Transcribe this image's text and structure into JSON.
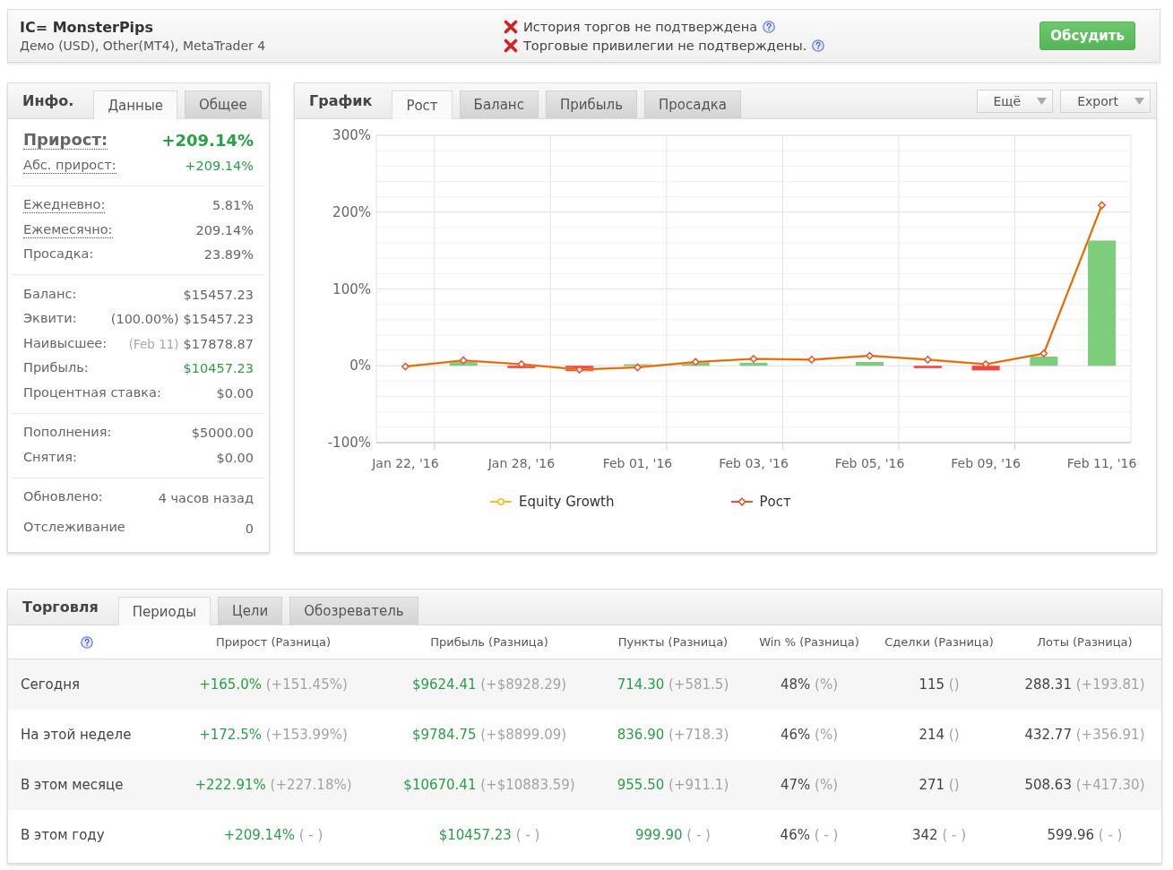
{
  "header": {
    "title": "IC= MonsterPips",
    "subtitle": "Демо (USD), Other(MT4), MetaTrader 4",
    "warnings": [
      {
        "text": "История торгов не подтверждена",
        "verified": false
      },
      {
        "text": "Торговые привилегии не подтверждены.",
        "verified": false
      }
    ],
    "button": "Обсудить"
  },
  "info_panel": {
    "title": "Инфо.",
    "tabs": [
      {
        "label": "Данные",
        "selected": true
      },
      {
        "label": "Общее",
        "selected": false
      }
    ],
    "sections": [
      {
        "rows": [
          {
            "kind": "headline",
            "label": "Прирост:",
            "value": "+209.14%",
            "dotted": true,
            "positive": true
          },
          {
            "kind": "row",
            "label": "Абс. прирост:",
            "value": "+209.14%",
            "dotted": true,
            "positive": true
          }
        ]
      },
      {
        "rows": [
          {
            "kind": "row",
            "label": "Ежедневно:",
            "value": "5.81%",
            "dotted": true,
            "positive": false
          },
          {
            "kind": "row",
            "label": "Ежемесячно:",
            "value": "209.14%",
            "dotted": true,
            "positive": false
          },
          {
            "kind": "row",
            "label": "Просадка:",
            "value": "23.89%",
            "dotted": false,
            "positive": false
          }
        ]
      },
      {
        "rows": [
          {
            "kind": "row",
            "label": "Баланс:",
            "value": "$15457.23",
            "dotted": false,
            "positive": false
          },
          {
            "kind": "row",
            "label": "Эквити:",
            "note": {
              "text": "(100.00%)",
              "muted": false
            },
            "value": "$15457.23",
            "dotted": false,
            "positive": false
          },
          {
            "kind": "row",
            "label": "Наивысшее:",
            "note": {
              "text": "(Feb 11)",
              "muted": true
            },
            "value": "$17878.87",
            "dotted": false,
            "positive": false
          },
          {
            "kind": "row",
            "label": "Прибыль:",
            "value": "$10457.23",
            "dotted": false,
            "positive": true
          },
          {
            "kind": "row",
            "label": "Процентная ставка:",
            "value": "$0.00",
            "dotted": false,
            "positive": false
          }
        ]
      },
      {
        "rows": [
          {
            "kind": "row",
            "label": "Пополнения:",
            "value": "$5000.00",
            "dotted": false,
            "positive": false
          },
          {
            "kind": "row",
            "label": "Снятия:",
            "value": "$0.00",
            "dotted": false,
            "positive": false
          }
        ]
      },
      {
        "rows": [
          {
            "kind": "row",
            "label": "Обновлено:",
            "value": "4 часов назад",
            "dotted": false,
            "positive": false
          },
          {
            "kind": "row",
            "label": "Отслеживание",
            "value": "0",
            "dotted": false,
            "positive": false
          }
        ]
      }
    ]
  },
  "chart_panel": {
    "title": "График",
    "tabs": [
      {
        "label": "Рост",
        "selected": true
      },
      {
        "label": "Баланс",
        "selected": false
      },
      {
        "label": "Прибыль",
        "selected": false
      },
      {
        "label": "Просадка",
        "selected": false
      }
    ],
    "menus": [
      "Ещё",
      "Export"
    ],
    "chart_data": {
      "type": "line",
      "categories": [
        "Jan 22, '16",
        null,
        "Jan 28, '16",
        null,
        "Feb 01, '16",
        null,
        "Feb 03, '16",
        null,
        "Feb 05, '16",
        null,
        "Feb 09, '16",
        null,
        "Feb 11, '16"
      ],
      "ylim": [
        -100,
        300
      ],
      "yticks": [
        {
          "value": 300,
          "label": "300%"
        },
        {
          "value": 200,
          "label": "200%"
        },
        {
          "value": 100,
          "label": "100%"
        },
        {
          "value": 0,
          "label": "0%"
        },
        {
          "value": -100,
          "label": "-100%"
        }
      ],
      "grid": true,
      "legend": "bottom",
      "series": [
        {
          "name": "Equity Growth",
          "color": "#f2c01e",
          "values": [
            -1,
            7,
            2,
            -5,
            -2,
            5,
            9,
            8,
            13,
            8,
            2,
            16,
            209
          ]
        },
        {
          "name": "Рост",
          "color": "#e8532b",
          "marker": "diamond",
          "values": [
            -1,
            7,
            2,
            -5,
            -2,
            5,
            9,
            8,
            13,
            8,
            2,
            16,
            209
          ]
        },
        {
          "type": "bar",
          "color": "#7dcd7d",
          "values": [
            null,
            6,
            null,
            null,
            2,
            5,
            4,
            null,
            5,
            null,
            null,
            12,
            163
          ]
        },
        {
          "type": "bar",
          "color": "#f04646",
          "values": [
            null,
            null,
            -3,
            -7,
            null,
            null,
            null,
            null,
            null,
            -3,
            -6,
            null,
            null
          ]
        }
      ]
    }
  },
  "trading_panel": {
    "title": "Торговля",
    "tabs": [
      {
        "label": "Периоды",
        "selected": true
      },
      {
        "label": "Цели",
        "selected": false
      },
      {
        "label": "Обозреватель",
        "selected": false
      }
    ],
    "columns": [
      "Прирост (Разница)",
      "Прибыль (Разница)",
      "Пункты (Разница)",
      "Win % (Разница)",
      "Сделки (Разница)",
      "Лоты (Разница)"
    ],
    "rows": [
      {
        "period": "Сегодня",
        "cells": [
          {
            "value": "+165.0%",
            "diff": "(+151.45%)",
            "positive": true
          },
          {
            "value": "$9624.41",
            "diff": "(+$8928.29)",
            "positive": true
          },
          {
            "value": "714.30",
            "diff": "(+581.5)",
            "positive": true
          },
          {
            "value": "48%",
            "diff": "(%)",
            "positive": false
          },
          {
            "value": "115",
            "diff": "()",
            "positive": false
          },
          {
            "value": "288.31",
            "diff": "(+193.81)",
            "positive": false
          }
        ]
      },
      {
        "period": "На этой неделе",
        "cells": [
          {
            "value": "+172.5%",
            "diff": "(+153.99%)",
            "positive": true
          },
          {
            "value": "$9784.75",
            "diff": "(+$8899.09)",
            "positive": true
          },
          {
            "value": "836.90",
            "diff": "(+718.3)",
            "positive": true
          },
          {
            "value": "46%",
            "diff": "(%)",
            "positive": false
          },
          {
            "value": "214",
            "diff": "()",
            "positive": false
          },
          {
            "value": "432.77",
            "diff": "(+356.91)",
            "positive": false
          }
        ]
      },
      {
        "period": "В этом месяце",
        "cells": [
          {
            "value": "+222.91%",
            "diff": "(+227.18%)",
            "positive": true
          },
          {
            "value": "$10670.41",
            "diff": "(+$10883.59)",
            "positive": true
          },
          {
            "value": "955.50",
            "diff": "(+911.1)",
            "positive": true
          },
          {
            "value": "47%",
            "diff": "(%)",
            "positive": false
          },
          {
            "value": "271",
            "diff": "()",
            "positive": false
          },
          {
            "value": "508.63",
            "diff": "(+417.30)",
            "positive": false
          }
        ]
      },
      {
        "period": "В этом году",
        "cells": [
          {
            "value": "+209.14%",
            "diff": "( - )",
            "positive": true
          },
          {
            "value": "$10457.23",
            "diff": "( - )",
            "positive": true
          },
          {
            "value": "999.90",
            "diff": "( - )",
            "positive": true
          },
          {
            "value": "46%",
            "diff": "( - )",
            "positive": false
          },
          {
            "value": "342",
            "diff": "( - )",
            "positive": false
          },
          {
            "value": "599.96",
            "diff": "( - )",
            "positive": false
          }
        ]
      }
    ]
  }
}
